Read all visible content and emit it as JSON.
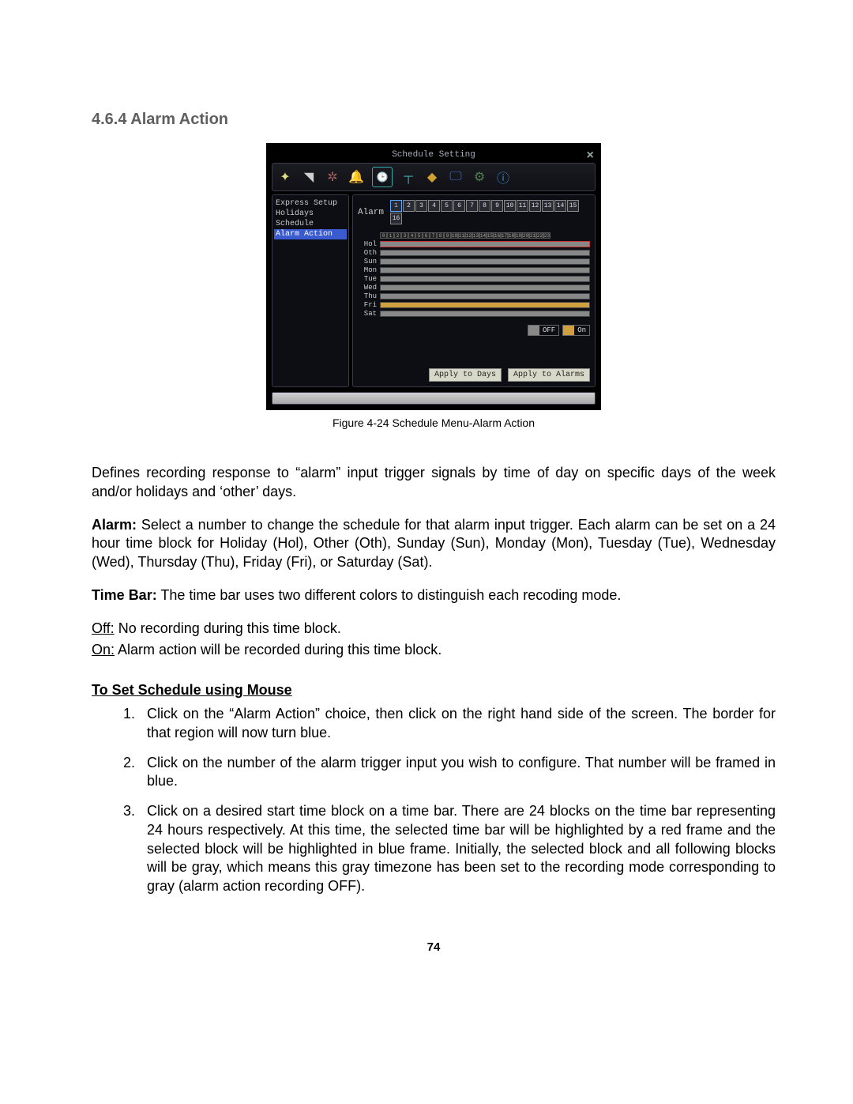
{
  "heading": "4.6.4 Alarm Action",
  "screenshot": {
    "title": "Schedule Setting",
    "sidebar": [
      "Express Setup",
      "Holidays",
      "Schedule",
      "Alarm Action"
    ],
    "sidebar_active_index": 3,
    "alarm_label": "Alarm",
    "alarm_numbers": [
      "1",
      "2",
      "3",
      "4",
      "5",
      "6",
      "7",
      "8",
      "9",
      "10",
      "11",
      "12",
      "13",
      "14",
      "15",
      "16"
    ],
    "alarm_active_index": 0,
    "hours": [
      "0",
      "1",
      "2",
      "3",
      "4",
      "5",
      "6",
      "7",
      "8",
      "9",
      "10",
      "11",
      "12",
      "13",
      "14",
      "15",
      "16",
      "17",
      "18",
      "19",
      "20",
      "21",
      "22",
      "23"
    ],
    "days": [
      {
        "label": "Hol",
        "on": false,
        "red": true
      },
      {
        "label": "Oth",
        "on": false,
        "red": false
      },
      {
        "label": "Sun",
        "on": false,
        "red": false
      },
      {
        "label": "Mon",
        "on": false,
        "red": false
      },
      {
        "label": "Tue",
        "on": false,
        "red": false
      },
      {
        "label": "Wed",
        "on": false,
        "red": false
      },
      {
        "label": "Thu",
        "on": false,
        "red": false
      },
      {
        "label": "Fri",
        "on": true,
        "red": false
      },
      {
        "label": "Sat",
        "on": false,
        "red": false
      }
    ],
    "legend_off": "OFF",
    "legend_on": "On",
    "apply_days": "Apply to Days",
    "apply_alarms": "Apply to Alarms"
  },
  "caption": "Figure 4-24 Schedule Menu-Alarm Action",
  "para1": "Defines recording response to “alarm” input trigger signals by time of day on specific days of the week and/or holidays and ‘other’ days.",
  "alarm_bold": "Alarm:",
  "alarm_text": " Select a number to change the schedule for that alarm input trigger. Each alarm can be set on a 24 hour time block for Holiday (Hol), Other (Oth), Sunday (Sun), Monday (Mon), Tuesday (Tue), Wednesday (Wed), Thursday (Thu), Friday (Fri), or Saturday (Sat).",
  "timebar_bold": "Time Bar:",
  "timebar_text": " The time bar uses two different colors to distinguish each recoding mode.",
  "off_u": "Off:",
  "off_text": " No recording during this time block.",
  "on_u": "On:",
  "on_text": " Alarm action will be recorded during this time block.",
  "subheading": "To Set Schedule using Mouse",
  "steps": [
    "Click on the “Alarm Action” choice, then click on the right hand side of the screen. The border for that region will now turn blue.",
    "Click on the number of the alarm trigger input you wish to configure.  That number will be framed in blue.",
    "Click on a desired start time block on a time bar. There are 24 blocks on the time bar representing 24 hours respectively. At this time, the selected time bar will be highlighted by a red frame and the selected block will be highlighted in blue frame. Initially, the selected block and all following blocks will be gray, which means this gray timezone has been set to the recording mode corresponding to gray (alarm action recording OFF)."
  ],
  "page_number": "74"
}
